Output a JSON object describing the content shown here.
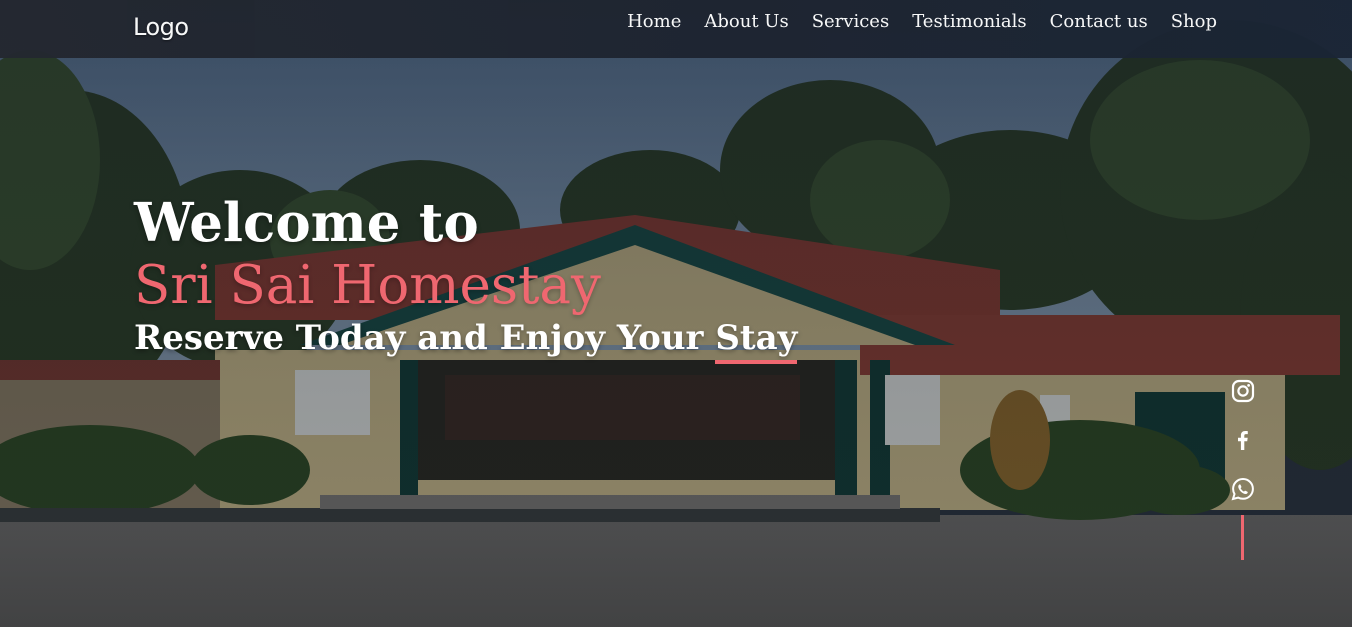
{
  "navbar": {
    "logo": "Logo",
    "links": [
      "Home",
      "About Us",
      "Services",
      "Testimonials",
      "Contact us",
      "Shop"
    ]
  },
  "hero": {
    "welcome": "Welcome to",
    "brand": "Sri Sai Homestay",
    "tagline_main": "Reserve Today and Enjoy Your ",
    "tagline_underlined": "Stay"
  },
  "social": {
    "icons": [
      "instagram-icon",
      "facebook-icon",
      "whatsapp-icon"
    ]
  },
  "colors": {
    "accent": "#ef6770",
    "text": "#ffffff",
    "navbar": "#1d2430"
  }
}
